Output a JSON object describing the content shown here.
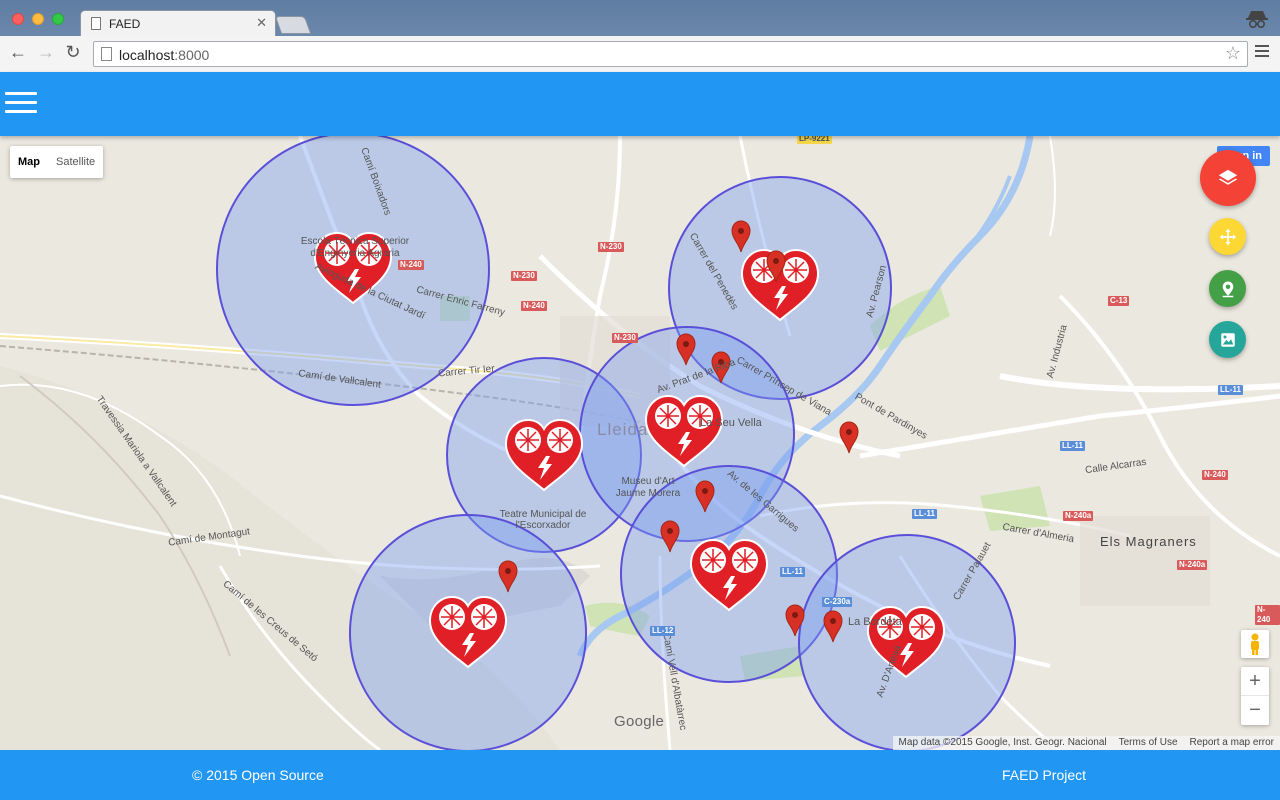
{
  "browser": {
    "tab_title": "FAED",
    "url_host": "localhost",
    "url_port": ":8000"
  },
  "map": {
    "type_controls": [
      "Map",
      "Satellite"
    ],
    "signin_label": "Sign in",
    "attribution": "Map data ©2015 Google, Inst. Geogr. Nacional",
    "terms": "Terms of Use",
    "report": "Report a map error",
    "logo": "Google",
    "zoom_in": "+",
    "zoom_out": "−",
    "labels": [
      "Escola Tècnica Superior d'Enginyeria Agrària",
      "Camí Boixadors",
      "Avinguda de la Ciutat Jardí",
      "Carrer Enric Farreny",
      "Camí de Vallcalent",
      "Carrer Tir Ier",
      "Lleida",
      "La Seu Vella",
      "Av. Prat de la Riba",
      "Carrer Príncep de Viana",
      "Museu d'Art Jaume Morera",
      "Teatre Municipal de l'Escorxador",
      "Av. de les Garrigues",
      "Pont de Pardinyes",
      "Av. Pearson",
      "Calle Alcarras",
      "Els Magraners",
      "Carrer d'Almeria",
      "Camí de Montagut",
      "Travessia Mariola a Vallcalent",
      "Camí de les Creus de Setó",
      "Camí Vell d'Albatàrrec",
      "La Bordeta",
      "Av. D'Artesa",
      "Av. Industria",
      "Carrer del Penedès",
      "Carrer Palauet"
    ],
    "road_shields": [
      "N-240",
      "N-230",
      "N-230",
      "N-240",
      "N-230",
      "LP-9221",
      "C-13",
      "LL-11",
      "LL-11",
      "LL-11",
      "N-240",
      "N-240a",
      "N-240a",
      "LL-11",
      "LL-12",
      "C-230a",
      "N-240"
    ],
    "aed_count": 8,
    "marker_count": 9
  },
  "fab": {
    "main_icon": "layers-icon",
    "move_icon": "move-icon",
    "location_icon": "location-pin-icon",
    "image_icon": "image-icon"
  },
  "footer": {
    "left": "© 2015 Open Source",
    "right": "FAED Project"
  },
  "colors": {
    "primary": "#2196f3",
    "fab_red": "#f44336",
    "fab_yellow": "#fdd835",
    "fab_green": "#43a047",
    "fab_teal": "#26a69a",
    "circle_fill": "#7a9ef0",
    "circle_stroke": "#5a4fd8",
    "heart": "#e02020"
  }
}
